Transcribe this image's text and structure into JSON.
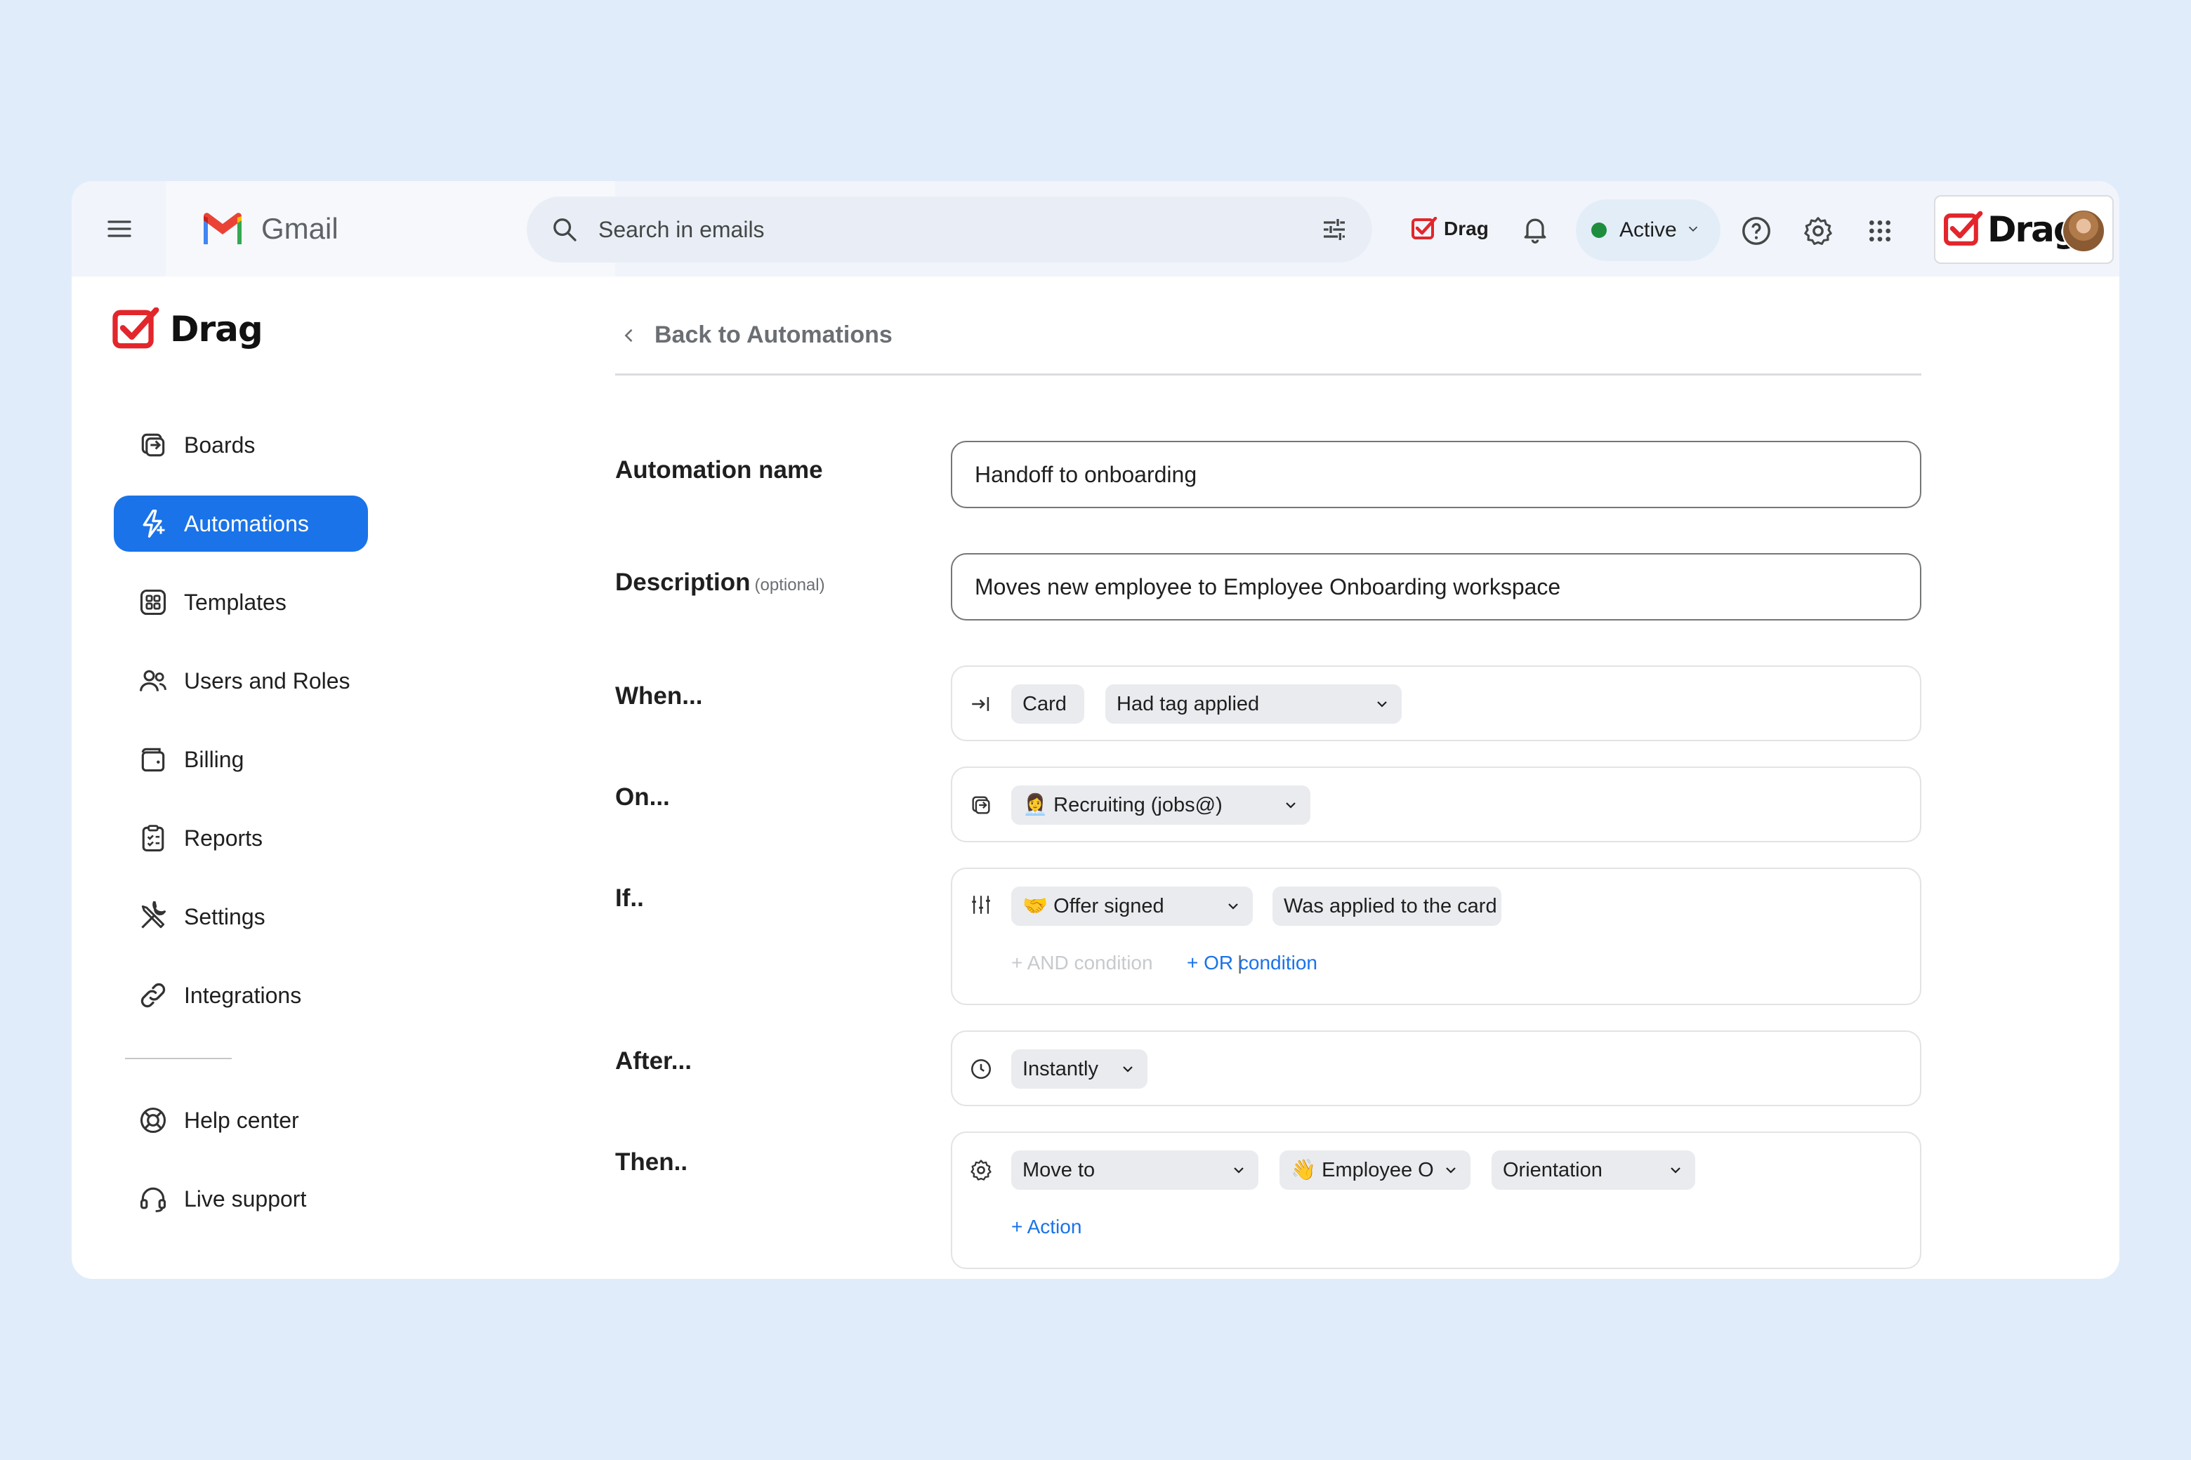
{
  "colors": {
    "background": "#e1ecfb",
    "accent": "#1a73e8",
    "brand_red": "#e2262b",
    "status_green": "#1e8e3e"
  },
  "gmail": {
    "app_name": "Gmail",
    "search_placeholder": "Search in emails",
    "drag_button_label": "Drag",
    "status_label": "Active",
    "brand_label": "Drag"
  },
  "sidebar": {
    "logo_text": "Drag",
    "items": [
      {
        "label": "Boards",
        "icon": "boards-icon"
      },
      {
        "label": "Automations",
        "icon": "automations-icon",
        "active": true
      },
      {
        "label": "Templates",
        "icon": "templates-icon"
      },
      {
        "label": "Users and Roles",
        "icon": "users-icon"
      },
      {
        "label": "Billing",
        "icon": "wallet-icon"
      },
      {
        "label": "Reports",
        "icon": "clipboard-icon"
      },
      {
        "label": "Settings",
        "icon": "tools-icon"
      },
      {
        "label": "Integrations",
        "icon": "link-icon"
      }
    ],
    "help_items": [
      {
        "label": "Help center",
        "icon": "lifebuoy-icon"
      },
      {
        "label": "Live support",
        "icon": "headset-icon"
      }
    ]
  },
  "main": {
    "back_label": "Back to Automations",
    "name_label": "Automation name",
    "name_value": "Handoff to onboarding",
    "description_label": "Description",
    "description_optional": "(optional)",
    "description_value": "Moves new employee to Employee Onboarding workspace",
    "when": {
      "label": "When...",
      "object": "Card",
      "trigger": "Had tag applied"
    },
    "on": {
      "label": "On...",
      "board": "👩‍💼 Recruiting (jobs@)"
    },
    "if": {
      "label": "If..",
      "tag": "🤝 Offer signed",
      "condition": "Was applied to the card",
      "and_link": "+ AND condition",
      "separator": "|",
      "or_link": "+ OR condition"
    },
    "after": {
      "label": "After...",
      "delay": "Instantly"
    },
    "then": {
      "label": "Then..",
      "action": "Move to",
      "workspace": "👋 Employee O",
      "stage": "Orientation",
      "add_action": "+ Action"
    }
  }
}
